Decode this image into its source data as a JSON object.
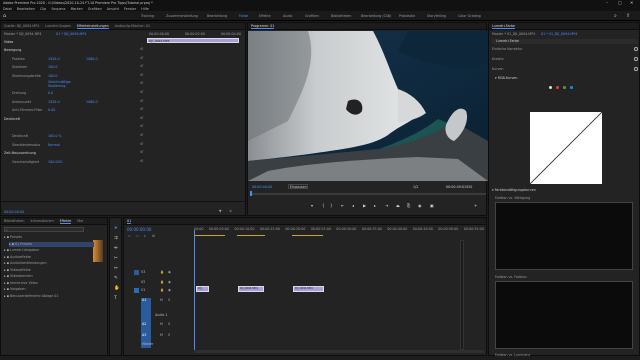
{
  "title": "Adobe Premiere Pro 2020 - G:\\Videos\\2020-10-24 FT-10 Premiere Pro Tipps\\Tutorial.prproj *",
  "window_controls": {
    "min": "–",
    "max": "□",
    "close": "✕"
  },
  "menu": [
    "Datei",
    "Bearbeiten",
    "Clip",
    "Sequenz",
    "Marken",
    "Grafiken",
    "Ansicht",
    "Fenster",
    "Hilfe"
  ],
  "workspaces": [
    "Training",
    "Zusammenstellung",
    "Bearbeitung",
    "Farbe",
    "Effekte",
    "Audio",
    "Grafiken",
    "Bibliotheken",
    "Bearbeitung (CS6)",
    "Protokolle",
    "Storytelling",
    "Color Grading"
  ],
  "active_workspace": "Farbe",
  "source": {
    "tabs": [
      "Quelle: DJI_0094.MP4",
      "Lumetri-Scopes",
      "Effekteinstellungen",
      "Audioclip-Mischer: 01"
    ],
    "active_tab": "Effekteinstellungen",
    "master": "Master * DJI_0094.MP4",
    "sequence": "01 * DJI_0094.MP4",
    "ruler": [
      "00:00:00:00",
      "00:00:02:00",
      "00:00:04:00"
    ],
    "clip_label": "DJI_0094.MP4",
    "section_video": "Video",
    "rows": [
      {
        "label": "Bewegung",
        "value": "",
        "value2": "",
        "fx": true
      },
      {
        "label": "Position",
        "value": "1920.0",
        "value2": "1080.0",
        "fx": false
      },
      {
        "label": "Skalieren",
        "value": "100.0",
        "value2": "",
        "fx": false
      },
      {
        "label": "Skalierungsbreite",
        "value": "100.0",
        "value2": "",
        "fx": false
      },
      {
        "label": "",
        "value": "Gleichmäßige Skalierung",
        "value2": "",
        "fx": false
      },
      {
        "label": "Drehung",
        "value": "0.0",
        "value2": "",
        "fx": false
      },
      {
        "label": "Ankerpunkt",
        "value": "1920.0",
        "value2": "1080.0",
        "fx": false
      },
      {
        "label": "Anti-Flimmer-Filter",
        "value": "0.00",
        "value2": "",
        "fx": false
      },
      {
        "label": "Deckkraft",
        "value": "",
        "value2": "",
        "fx": true
      },
      {
        "label": "",
        "value": "",
        "value2": "",
        "fx": false
      },
      {
        "label": "Deckkraft",
        "value": "100.0 %",
        "value2": "",
        "fx": false
      },
      {
        "label": "Überblendmodus",
        "value": "Normal",
        "value2": "",
        "fx": false
      },
      {
        "label": "Zeit-Neuzuordnung",
        "value": "",
        "value2": "",
        "fx": true
      },
      {
        "label": "Geschwindigkeit",
        "value": "100.00%",
        "value2": "",
        "fx": false
      }
    ],
    "timecode": "00:00:00:00"
  },
  "program": {
    "tab": "Programm: 01",
    "timecode": "00:00:00:00",
    "fit": "Einpassen",
    "ratio": "1/2",
    "duration": "00:00:49:01920"
  },
  "lumetri": {
    "tabs": [
      "Lumetri-Farbe"
    ],
    "master": "Master * 01_DJI_0094.MP4",
    "sequence": "01 * 01_DJI_0094.MP4",
    "fx_name": "Lumetri-Farbe",
    "sections": [
      "Einfache Korrektur",
      "Kreativ",
      "Kurven"
    ],
    "subsection": "RGB-Kurven",
    "hsl": "Farbtonsättigungskurven",
    "hue_labels": [
      "Farbton vs. Sättigung",
      "Farbton vs. Farbton",
      "Farbton vs. Luminanz"
    ],
    "dot_colors": [
      "#ffffff",
      "#e53935",
      "#43a047",
      "#1e88e5"
    ]
  },
  "project": {
    "tabs": [
      "Bibliotheken",
      "Informationen",
      "Effekte",
      "Mar"
    ],
    "active_tab": "Effekte",
    "search_placeholder": "",
    "items": [
      {
        "label": "Presets",
        "selected": false,
        "indent": 0
      },
      {
        "label": "01 Presets",
        "selected": true,
        "indent": 1
      },
      {
        "label": "Lumetri-Vorgaben",
        "selected": false,
        "indent": 0
      },
      {
        "label": "Audioeffekte",
        "selected": false,
        "indent": 0
      },
      {
        "label": "Audioüberblendungen",
        "selected": false,
        "indent": 0
      },
      {
        "label": "Videoeffekte",
        "selected": false,
        "indent": 0
      },
      {
        "label": "Videoblenden",
        "selected": false,
        "indent": 0
      },
      {
        "label": "Immersive Video",
        "selected": false,
        "indent": 0
      },
      {
        "label": "Vorgaben",
        "selected": false,
        "indent": 0
      },
      {
        "label": "Benutzerdefinierte Ablage 01",
        "selected": false,
        "indent": 0
      }
    ]
  },
  "timeline": {
    "tab": "01",
    "timecode": "00:00:00:00",
    "ruler": [
      "00:00",
      "00:00:05:00",
      "00:00:10:00",
      "00:00:15:00",
      "00:00:20:00",
      "00:00:25:00",
      "00:00:30:00",
      "00:00:35:00",
      "00:00:40:00",
      "00:00:45:00",
      "00:00:50:00",
      "00:00:55:00"
    ],
    "video_tracks": [
      "V3",
      "V2",
      "V1"
    ],
    "audio_tracks": [
      "A1",
      "A2",
      "A3"
    ],
    "audio_label": "Audio 1",
    "master": "Master",
    "clips": [
      {
        "label": "DJI_"
      },
      {
        "label": "DJI_0094.MP4"
      },
      {
        "label": "DJI_0094.MP4"
      }
    ]
  }
}
